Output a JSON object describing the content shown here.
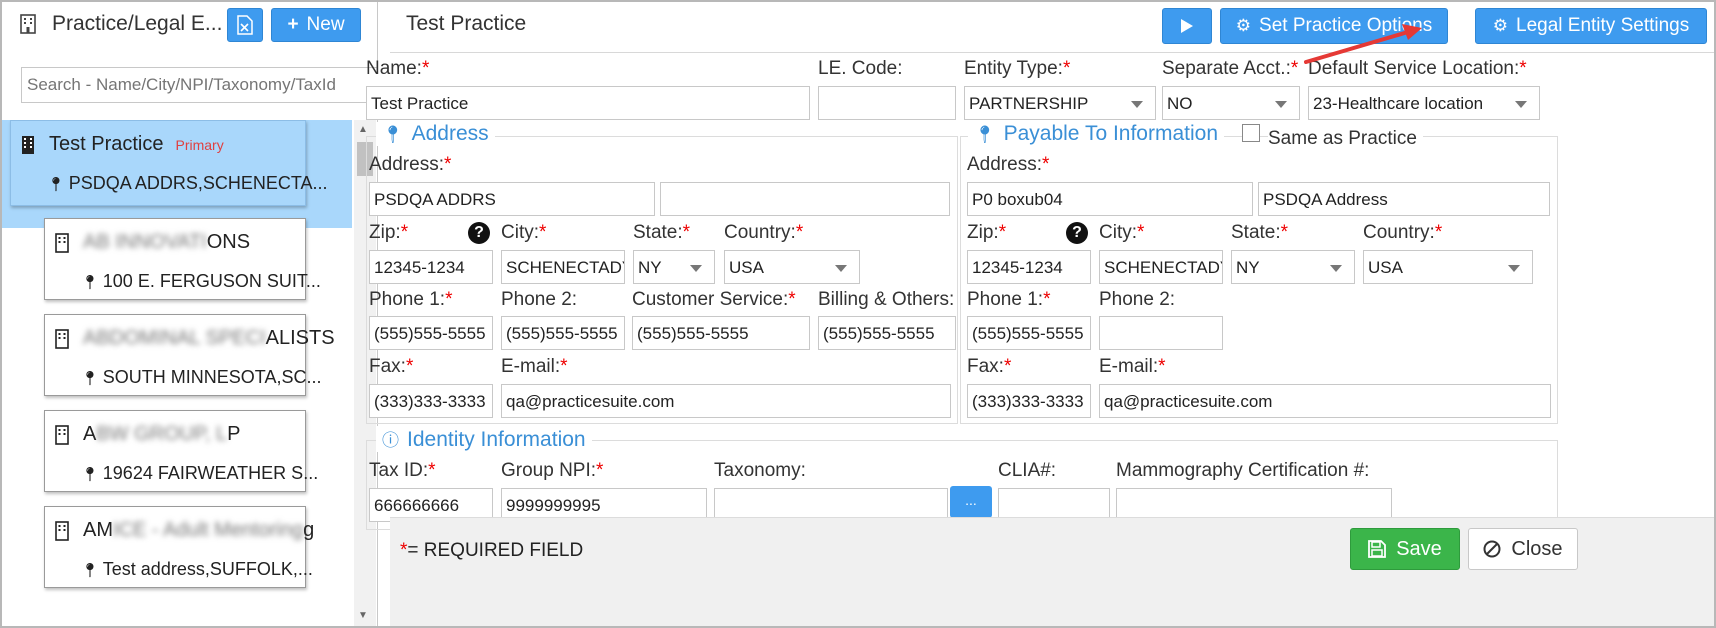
{
  "left": {
    "title": "Practice/Legal E...",
    "new_label": "New",
    "export_icon": "excel-export-icon",
    "search_placeholder": "Search - Name/City/NPI/Taxonomy/TaxId",
    "items": [
      {
        "name": "Test Practice",
        "badge": "Primary",
        "address": "PSDQA ADDRS,SCHENECTA..."
      },
      {
        "name_blurred": "AB INNOVATI",
        "name_visible": "ONS",
        "address": "100 E. FERGUSON SUIT..."
      },
      {
        "name_blurred": "ABDOMINAL SPECI",
        "name_visible": "ALISTS",
        "address": "SOUTH MINNESOTA,SC..."
      },
      {
        "name_visible": "A",
        "name_blurred": "BW GROUP, L",
        "name_visible2": "P",
        "address": "19624 FAIRWEATHER S..."
      },
      {
        "name_visible": "AM",
        "name_blurred": "ICE - Adult Mentoring",
        "name_visible2": "g",
        "address": "Test address,SUFFOLK,..."
      }
    ]
  },
  "header": {
    "title": "Test Practice",
    "set_options_label": "Set Practice Options",
    "legal_settings_label": "Legal Entity Settings"
  },
  "form": {
    "name_label": "Name:",
    "name_value": "Test Practice",
    "lecode_label": "LE. Code:",
    "lecode_value": "",
    "entity_type_label": "Entity Type:",
    "entity_type_value": "PARTNERSHIP",
    "separate_label": "Separate Acct.:",
    "separate_value": "NO",
    "default_loc_label": "Default Service Location:",
    "default_loc_value": "23-Healthcare location"
  },
  "address": {
    "legend": "Address",
    "address_label": "Address:",
    "address1": "PSDQA ADDRS",
    "address2": "",
    "zip_label": "Zip:",
    "zip": "12345-1234",
    "city_label": "City:",
    "city": "SCHENECTADY",
    "state_label": "State:",
    "state": "NY",
    "country_label": "Country:",
    "country": "USA",
    "phone1_label": "Phone 1:",
    "phone1": "(555)555-5555",
    "phone2_label": "Phone 2:",
    "phone2": "(555)555-5555",
    "cs_label": "Customer Service:",
    "cs": "(555)555-5555",
    "billing_label": "Billing & Others:",
    "billing": "(555)555-5555",
    "fax_label": "Fax:",
    "fax": "(333)333-3333",
    "email_label": "E-mail:",
    "email": "qa@practicesuite.com"
  },
  "payable": {
    "legend": "Payable To Information",
    "same_label": "Same as Practice",
    "address_label": "Address:",
    "address1": "P0 boxub04",
    "address2": "PSDQA Address",
    "zip_label": "Zip:",
    "zip": "12345-1234",
    "city_label": "City:",
    "city": "SCHENECTADY",
    "state_label": "State:",
    "state": "NY",
    "country_label": "Country:",
    "country": "USA",
    "phone1_label": "Phone 1:",
    "phone1": "(555)555-5555",
    "phone2_label": "Phone 2:",
    "phone2": "",
    "fax_label": "Fax:",
    "fax": "(333)333-3333",
    "email_label": "E-mail:",
    "email": "qa@practicesuite.com"
  },
  "identity": {
    "legend": "Identity Information",
    "taxid_label": "Tax ID:",
    "taxid": "666666666",
    "npi_label": "Group NPI:",
    "npi": "9999999995",
    "taxonomy_label": "Taxonomy:",
    "taxonomy": "",
    "dots_label": "...",
    "clia_label": "CLIA#:",
    "clia": "",
    "mammo_label": "Mammography Certification #:",
    "mammo": ""
  },
  "footer": {
    "req_star": "*",
    "req_text": "= REQUIRED FIELD",
    "save_label": "Save",
    "close_label": "Close"
  },
  "required_mark": "*",
  "colors": {
    "accent": "#3e9bef",
    "save": "#3bb54a",
    "required": "#e00000",
    "selected": "#a9d7fb",
    "arrow": "#e53935"
  }
}
